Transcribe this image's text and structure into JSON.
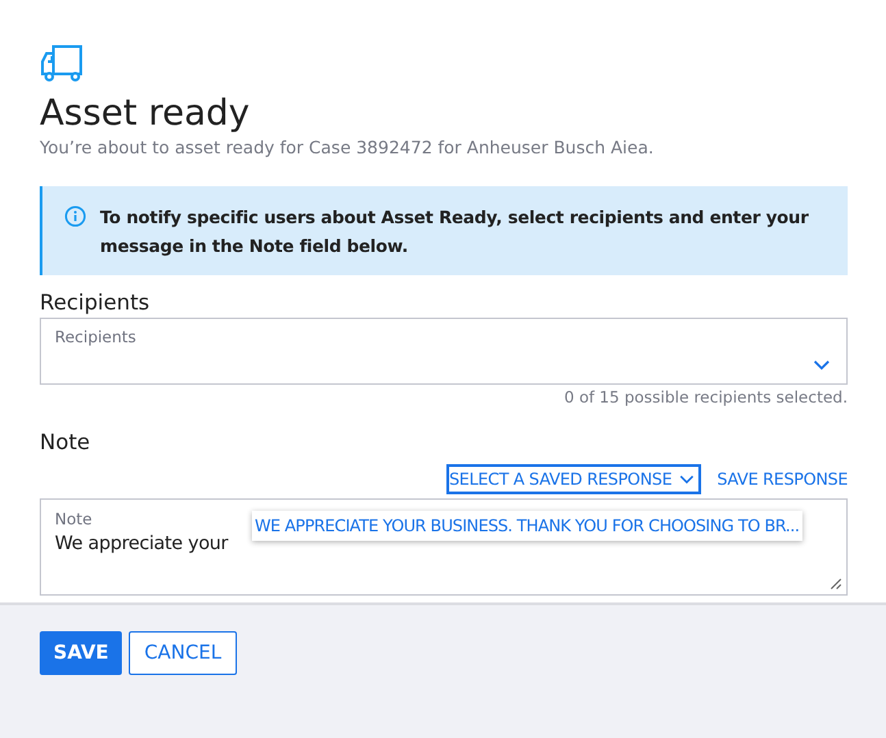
{
  "title": "Asset ready",
  "subtitle": "You’re about to asset ready for Case 3892472 for Anheuser Busch Aiea.",
  "info": "To notify specific users about Asset Ready, select recipients and enter your message in the Note field below.",
  "recipients": {
    "heading": "Recipients",
    "label": "Recipients",
    "helper": "0 of 15 possible recipients selected."
  },
  "note": {
    "heading": "Note",
    "label": "Note",
    "value": "We appreciate your",
    "saved_response_select": "SELECT A SAVED RESPONSE",
    "save_response": "SAVE RESPONSE",
    "tooltip": "WE APPRECIATE YOUR BUSINESS. THANK YOU FOR CHOOSING TO BR..."
  },
  "buttons": [
    {
      "label": "SAVE",
      "kind": "primary"
    },
    {
      "label": "CANCEL",
      "kind": "secondary"
    }
  ]
}
